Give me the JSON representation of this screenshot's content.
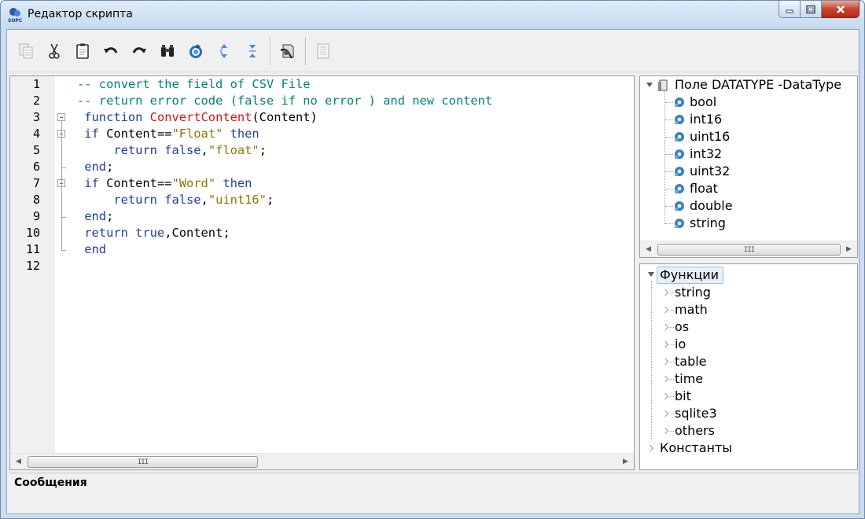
{
  "window": {
    "title": "Редактор скрипта",
    "app_icon_label": "SOPC",
    "controls": [
      "minimize-icon",
      "maximize-icon",
      "close-icon"
    ]
  },
  "toolbar": {
    "buttons": [
      {
        "name": "copy",
        "icon": "copy-icon",
        "enabled": false
      },
      {
        "name": "cut",
        "icon": "scissors-icon",
        "enabled": true
      },
      {
        "name": "paste",
        "icon": "clipboard-icon",
        "enabled": true
      },
      {
        "name": "undo",
        "icon": "undo-icon",
        "enabled": true
      },
      {
        "name": "redo",
        "icon": "redo-icon",
        "enabled": true
      },
      {
        "name": "find",
        "icon": "binoculars-icon",
        "enabled": true
      },
      {
        "name": "refresh",
        "icon": "refresh-icon",
        "enabled": true
      },
      {
        "name": "expand",
        "icon": "expand-icon",
        "enabled": true
      },
      {
        "name": "collapse",
        "icon": "collapse-icon",
        "enabled": true
      },
      {
        "name": "check",
        "icon": "check-script-icon",
        "enabled": true
      },
      {
        "name": "document",
        "icon": "document-icon",
        "enabled": false
      }
    ]
  },
  "editor": {
    "line_numbers": [
      "1",
      "2",
      "3",
      "4",
      "5",
      "6",
      "7",
      "8",
      "9",
      "10",
      "11",
      "12"
    ],
    "lines": [
      [
        {
          "t": "-- convert the field of CSV File",
          "c": "comment"
        }
      ],
      [
        {
          "t": "-- return error code (false if no error ) and new content",
          "c": "comment"
        }
      ],
      [
        {
          "t": " function ",
          "c": "kw"
        },
        {
          "t": "ConvertContent",
          "c": "fn"
        },
        {
          "t": "(Content)",
          "c": "plain"
        }
      ],
      [
        {
          "t": " if ",
          "c": "kw"
        },
        {
          "t": "Content==",
          "c": "plain"
        },
        {
          "t": "\"Float\"",
          "c": "str"
        },
        {
          "t": " then",
          "c": "kw"
        }
      ],
      [
        {
          "t": "     return false",
          "c": "kw"
        },
        {
          "t": ",",
          "c": "plain"
        },
        {
          "t": "\"float\"",
          "c": "str"
        },
        {
          "t": ";",
          "c": "plain"
        }
      ],
      [
        {
          "t": " end",
          "c": "kw"
        },
        {
          "t": ";",
          "c": "plain"
        }
      ],
      [
        {
          "t": " if ",
          "c": "kw"
        },
        {
          "t": "Content==",
          "c": "plain"
        },
        {
          "t": "\"Word\"",
          "c": "str"
        },
        {
          "t": " then",
          "c": "kw"
        }
      ],
      [
        {
          "t": "     return false",
          "c": "kw"
        },
        {
          "t": ",",
          "c": "plain"
        },
        {
          "t": "\"uint16\"",
          "c": "str"
        },
        {
          "t": ";",
          "c": "plain"
        }
      ],
      [
        {
          "t": " end",
          "c": "kw"
        },
        {
          "t": ";",
          "c": "plain"
        }
      ],
      [
        {
          "t": " return true",
          "c": "kw"
        },
        {
          "t": ",Content;",
          "c": "plain"
        }
      ],
      [
        {
          "t": " end",
          "c": "kw"
        }
      ],
      []
    ],
    "scrollbar_grip": "III"
  },
  "types_tree": {
    "root_label": "Поле DATATYPE -DataType",
    "items": [
      "bool",
      "int16",
      "uint16",
      "int32",
      "uint32",
      "float",
      "double",
      "string"
    ],
    "scrollbar_grip": "III"
  },
  "functions_tree": {
    "root_label": "Функции",
    "items": [
      "string",
      "math",
      "os",
      "io",
      "table",
      "time",
      "bit",
      "sqlite3",
      "others"
    ],
    "constants_label": "Константы"
  },
  "messages": {
    "title": "Сообщения"
  },
  "colors": {
    "comment": "#008080",
    "keyword": "#1e3e9a",
    "function_name": "#d21414",
    "string": "#8a7a00"
  }
}
